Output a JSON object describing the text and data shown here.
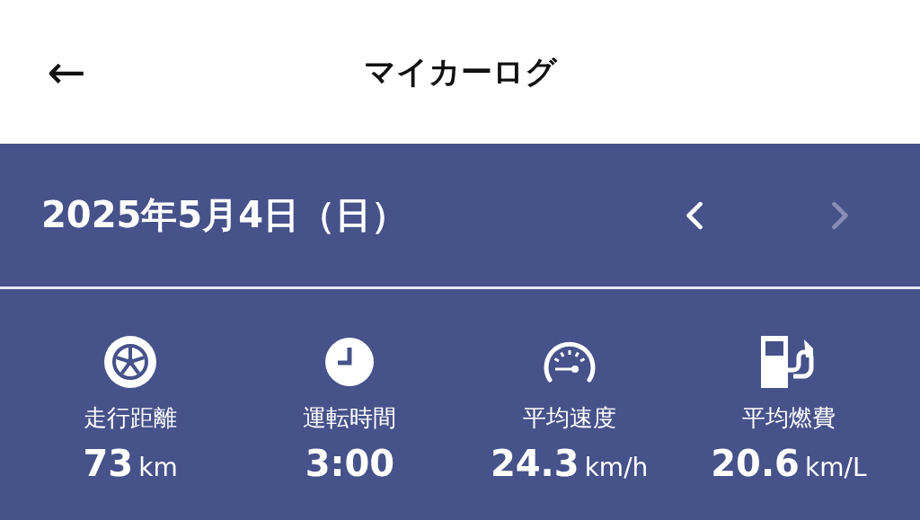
{
  "header": {
    "back_icon": "←",
    "title": "マイカーログ"
  },
  "date_bar": {
    "date": "2025年5月4日（日）",
    "prev": {
      "disabled": false
    },
    "next": {
      "disabled": true
    }
  },
  "stats": [
    {
      "kind": "tire",
      "label": "走行距離",
      "value": "73",
      "unit": "km"
    },
    {
      "kind": "clock",
      "label": "運転時間",
      "value": "3:00"
    },
    {
      "kind": "speedometer",
      "label": "平均速度",
      "value": "24.3",
      "unit": "km/h"
    },
    {
      "kind": "fuel",
      "label": "平均燃費",
      "value": "20.6",
      "unit": "km/L"
    }
  ]
}
